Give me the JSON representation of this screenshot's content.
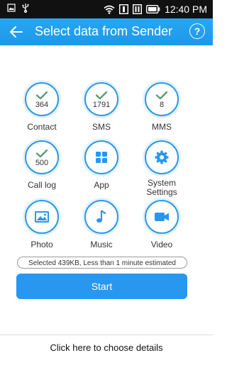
{
  "status_bar": {
    "time": "12:40 PM"
  },
  "app_bar": {
    "title": "Select data from Sender",
    "help_label": "?"
  },
  "items": [
    {
      "id": "contact",
      "label": "Contact",
      "count": "364",
      "selected": true,
      "icon": "check-icon"
    },
    {
      "id": "sms",
      "label": "SMS",
      "count": "1791",
      "selected": true,
      "icon": "check-icon"
    },
    {
      "id": "mms",
      "label": "MMS",
      "count": "8",
      "selected": true,
      "icon": "check-icon"
    },
    {
      "id": "call-log",
      "label": "Call log",
      "count": "500",
      "selected": true,
      "icon": "check-icon"
    },
    {
      "id": "app",
      "label": "App",
      "count": "",
      "selected": false,
      "icon": "grid-icon"
    },
    {
      "id": "system-settings",
      "label": "System Settings",
      "count": "",
      "selected": false,
      "icon": "gear-icon"
    },
    {
      "id": "photo",
      "label": "Photo",
      "count": "",
      "selected": false,
      "icon": "image-icon"
    },
    {
      "id": "music",
      "label": "Music",
      "count": "",
      "selected": false,
      "icon": "music-note-icon"
    },
    {
      "id": "video",
      "label": "Video",
      "count": "",
      "selected": false,
      "icon": "video-camera-icon"
    }
  ],
  "summary": "Selected 439KB, Less than 1 minute estimated",
  "start_label": "Start",
  "details_link": "Click here to choose details",
  "colors": {
    "accent": "#2897ef",
    "app_bar": "#1d97ec",
    "status_bar": "#111111"
  }
}
